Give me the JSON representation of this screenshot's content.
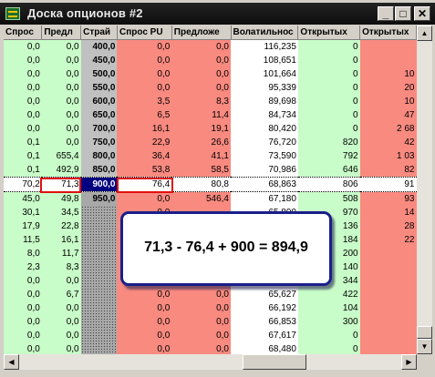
{
  "window": {
    "title": "Доска опционов #2",
    "buttons": {
      "minimize": "_",
      "maximize": "□",
      "close": "✕"
    }
  },
  "columns": [
    "Спрос",
    "Предл",
    "Страй",
    "Спрос PU",
    "Предложе",
    "Волатильнос",
    "Открытых",
    "Открытых"
  ],
  "rows": [
    [
      "0,0",
      "0,0",
      "400,0",
      "0,0",
      "0,0",
      "116,235",
      "0",
      ""
    ],
    [
      "0,0",
      "0,0",
      "450,0",
      "0,0",
      "0,0",
      "108,651",
      "0",
      ""
    ],
    [
      "0,0",
      "0,0",
      "500,0",
      "0,0",
      "0,0",
      "101,664",
      "0",
      "10"
    ],
    [
      "0,0",
      "0,0",
      "550,0",
      "0,0",
      "0,0",
      "95,339",
      "0",
      "20"
    ],
    [
      "0,0",
      "0,0",
      "600,0",
      "3,5",
      "8,3",
      "89,698",
      "0",
      "10"
    ],
    [
      "0,0",
      "0,0",
      "650,0",
      "6,5",
      "11,4",
      "84,734",
      "0",
      "47"
    ],
    [
      "0,0",
      "0,0",
      "700,0",
      "16,1",
      "19,1",
      "80,420",
      "0",
      "2 68"
    ],
    [
      "0,1",
      "0,0",
      "750,0",
      "22,9",
      "26,6",
      "76,720",
      "820",
      "42"
    ],
    [
      "0,1",
      "655,4",
      "800,0",
      "36,4",
      "41,1",
      "73,590",
      "792",
      "1 03"
    ],
    [
      "0,1",
      "492,9",
      "850,0",
      "53,8",
      "58,5",
      "70,986",
      "646",
      "82"
    ],
    [
      "70,2",
      "71,3",
      "900,0",
      "76,4",
      "80,8",
      "68,863",
      "806",
      "91"
    ],
    [
      "45,0",
      "49,8",
      "950,0",
      "0,0",
      "546,4",
      "67,180",
      "508",
      "93"
    ],
    [
      "30,1",
      "34,5",
      "",
      "0,0",
      "",
      "65,800",
      "970",
      "14"
    ],
    [
      "17,9",
      "22,8",
      "",
      "",
      "",
      "",
      "136",
      "28"
    ],
    [
      "11,5",
      "16,1",
      "",
      "",
      "",
      "",
      "184",
      "22"
    ],
    [
      "8,0",
      "11,7",
      "",
      "",
      "",
      "",
      "200",
      ""
    ],
    [
      "2,3",
      "8,3",
      "",
      "",
      "",
      "",
      "140",
      ""
    ],
    [
      "0,0",
      "0,0",
      "",
      "",
      "",
      "",
      "344",
      ""
    ],
    [
      "0,0",
      "6,7",
      "",
      "0,0",
      "0,0",
      "65,627",
      "422",
      ""
    ],
    [
      "0,0",
      "0,0",
      "",
      "0,0",
      "0,0",
      "66,192",
      "104",
      ""
    ],
    [
      "0,0",
      "0,0",
      "",
      "0,0",
      "0,0",
      "66,853",
      "300",
      ""
    ],
    [
      "0,0",
      "0,0",
      "",
      "0,0",
      "0,0",
      "67,617",
      "0",
      ""
    ],
    [
      "0,0",
      "0,0",
      "",
      "0,0",
      "0,0",
      "68,480",
      "0",
      ""
    ]
  ],
  "selected_row_index": 10,
  "callout": {
    "text": "71,3 - 76,4 + 900 = 894,9"
  },
  "colors": {
    "call_bg": "#c8fcc8",
    "put_bg": "#f98a80",
    "strike_bg": "#c0c0c0",
    "selected_strike": "#000080",
    "highlight": "#e01010",
    "callout_border": "#1a1f8a"
  }
}
